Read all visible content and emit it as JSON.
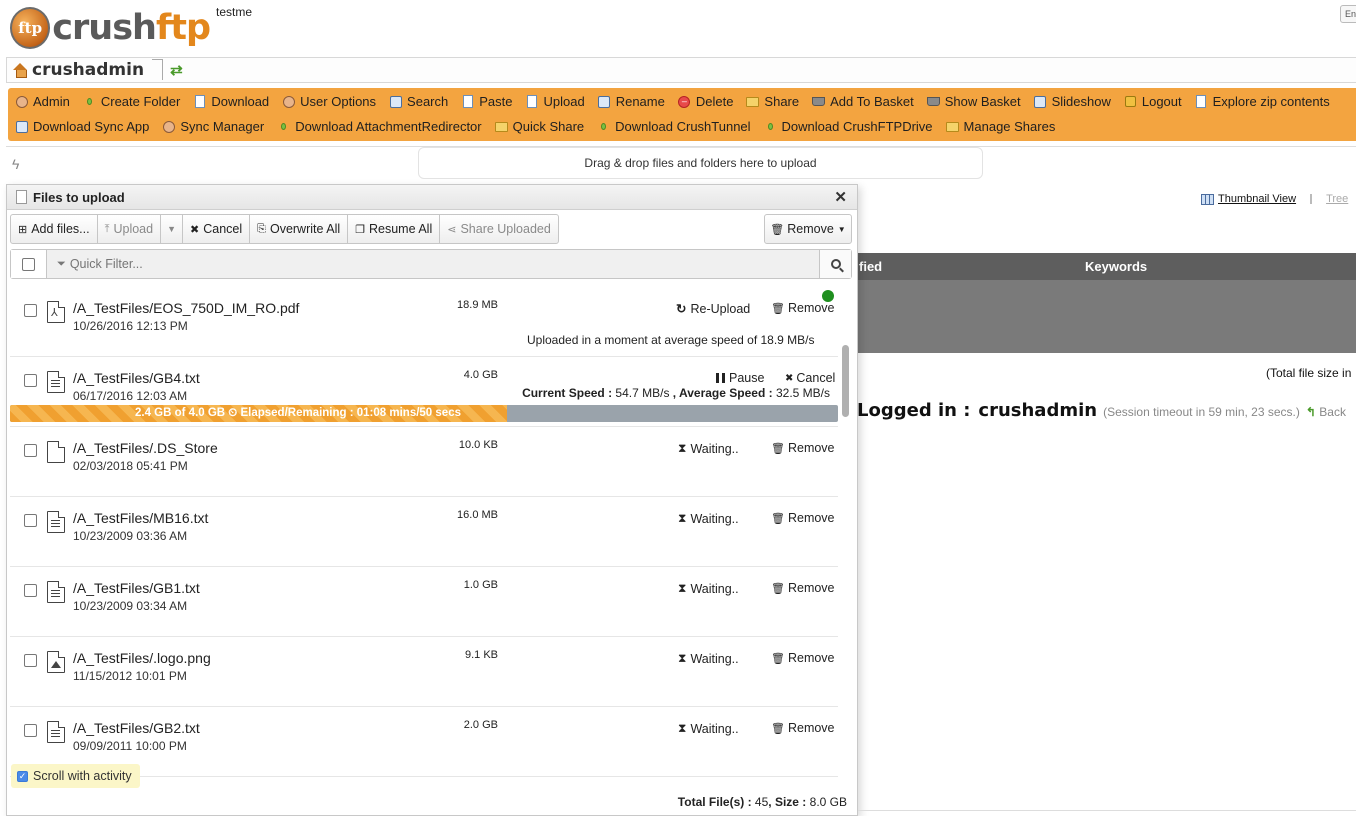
{
  "app": {
    "logo_text_1": "crush",
    "logo_text_2": "ftp",
    "site_name": "testme",
    "language_select": "En"
  },
  "breadcrumb": {
    "root_label": "crushadmin"
  },
  "toolbar": {
    "row1": [
      {
        "label": "Admin",
        "icon": "admin-user-icon"
      },
      {
        "label": "Create Folder",
        "icon": "create-folder-icon"
      },
      {
        "label": "Download",
        "icon": "download-icon"
      },
      {
        "label": "User Options",
        "icon": "user-options-icon"
      },
      {
        "label": "Search",
        "icon": "search-icon"
      },
      {
        "label": "Paste",
        "icon": "paste-icon"
      },
      {
        "label": "Upload",
        "icon": "upload-icon"
      },
      {
        "label": "Rename",
        "icon": "rename-icon"
      },
      {
        "label": "Delete",
        "icon": "delete-icon"
      },
      {
        "label": "Share",
        "icon": "share-icon"
      },
      {
        "label": "Add To Basket",
        "icon": "basket-add-icon"
      },
      {
        "label": "Show Basket",
        "icon": "basket-icon"
      },
      {
        "label": "Slideshow",
        "icon": "slideshow-icon"
      },
      {
        "label": "Logout",
        "icon": "lock-icon"
      },
      {
        "label": "Explore zip contents",
        "icon": "zip-icon"
      }
    ],
    "row2": [
      {
        "label": "Download Sync App",
        "icon": "sync-app-icon"
      },
      {
        "label": "Sync Manager",
        "icon": "sync-manager-icon"
      },
      {
        "label": "Download AttachmentRedirector",
        "icon": "bullet-icon"
      },
      {
        "label": "Quick Share",
        "icon": "quick-share-icon"
      },
      {
        "label": "Download CrushTunnel",
        "icon": "bullet-icon"
      },
      {
        "label": "Download CrushFTPDrive",
        "icon": "bullet-icon"
      },
      {
        "label": "Manage Shares",
        "icon": "manage-shares-icon"
      }
    ]
  },
  "dropzone": {
    "text": "Drag & drop files and folders here to upload"
  },
  "background": {
    "thumbnail_view": "Thumbnail View",
    "tree_view": "Tree",
    "col_modified": "fied",
    "col_keywords": "Keywords",
    "total_file_size": "(Total file size in",
    "logged_in_label": "Logged in :",
    "logged_in_user": "crushadmin",
    "session_timeout": "(Session timeout in 59 min, 23 secs.)",
    "back": "Back"
  },
  "upload_panel": {
    "title": "Files to upload",
    "buttons": {
      "add_files": "Add files...",
      "upload": "Upload",
      "cancel": "Cancel",
      "overwrite_all": "Overwrite All",
      "resume_all": "Resume All",
      "share_uploaded": "Share Uploaded",
      "remove": "Remove"
    },
    "filter_placeholder": "Quick Filter...",
    "files": [
      {
        "name": "/A_TestFiles/EOS_750D_IM_RO.pdf",
        "date": "10/26/2016 12:13 PM",
        "size": "18.9 MB",
        "type": "pdf",
        "status": "Re-Upload",
        "action": "Remove",
        "message": "Uploaded in a moment at average speed of 18.9 MB/s"
      },
      {
        "name": "/A_TestFiles/GB4.txt",
        "date": "06/17/2016 12:03 AM",
        "size": "4.0 GB",
        "type": "txt",
        "pause": "Pause",
        "cancel": "Cancel",
        "current_speed_label": "Current Speed :",
        "current_speed": "54.7 MB/s",
        "average_speed_label": ", Average Speed :",
        "average_speed": "32.5 MB/s",
        "progress_text": "2.4 GB of 4.0 GB ⏲ Elapsed/Remaining : 01:08 mins/50 secs",
        "progress_fraction": 0.6
      },
      {
        "name": "/A_TestFiles/.DS_Store",
        "date": "02/03/2018 05:41 PM",
        "size": "10.0 KB",
        "type": "file",
        "status": "Waiting..",
        "action": "Remove"
      },
      {
        "name": "/A_TestFiles/MB16.txt",
        "date": "10/23/2009 03:36 AM",
        "size": "16.0 MB",
        "type": "txt",
        "status": "Waiting..",
        "action": "Remove"
      },
      {
        "name": "/A_TestFiles/GB1.txt",
        "date": "10/23/2009 03:34 AM",
        "size": "1.0 GB",
        "type": "txt",
        "status": "Waiting..",
        "action": "Remove"
      },
      {
        "name": "/A_TestFiles/.logo.png",
        "date": "11/15/2012 10:01 PM",
        "size": "9.1 KB",
        "type": "img",
        "status": "Waiting..",
        "action": "Remove"
      },
      {
        "name": "/A_TestFiles/GB2.txt",
        "date": "09/09/2011 10:00 PM",
        "size": "2.0 GB",
        "type": "txt",
        "status": "Waiting..",
        "action": "Remove"
      }
    ],
    "scroll_with_activity": "Scroll with activity",
    "totals_files_label": "Total File(s) :",
    "totals_files": "45",
    "totals_size_label": ", Size :",
    "totals_size": "8.0 GB"
  },
  "colors": {
    "toolbar": "#f3a440",
    "progress_fill": "#f0a030",
    "progress_track": "#9aa3ab",
    "complete_dot": "#1f8f1f"
  }
}
